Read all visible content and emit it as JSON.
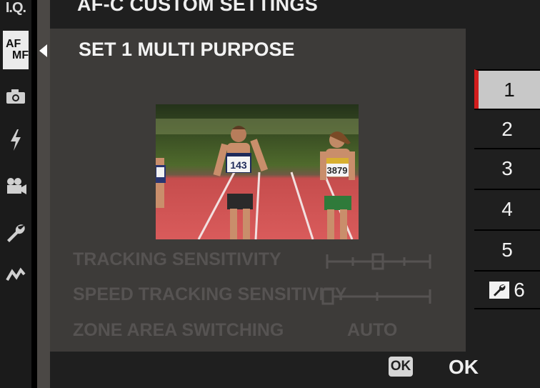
{
  "rail": {
    "iq_label": "I.Q.",
    "af_label_top": "AF",
    "af_label_bottom": "MF",
    "icons": [
      "camera-icon",
      "flash-icon",
      "movie-camera-icon",
      "wrench-icon",
      "connection-icon"
    ]
  },
  "header": {
    "title": "AF-C CUSTOM SETTINGS"
  },
  "panel": {
    "subtitle": "SET 1 MULTI PURPOSE",
    "settings": [
      {
        "label": "TRACKING SENSITIVITY",
        "slider_level": 2,
        "slider_steps": 5
      },
      {
        "label": "SPEED TRACKING SENSITIVITY",
        "slider_level": 0,
        "slider_steps": 3
      },
      {
        "label": "ZONE AREA SWITCHING",
        "value": "AUTO"
      }
    ]
  },
  "list": {
    "items": [
      "1",
      "2",
      "3",
      "4",
      "5",
      "6"
    ],
    "selected_index": 0,
    "custom_item_icon": "wrench-icon"
  },
  "footer": {
    "ok_icon_text": "OK",
    "ok_label": "OK"
  },
  "colors": {
    "accent": "#d21c1c",
    "panel": "#3d3b39",
    "selected": "#c8c8c8"
  }
}
